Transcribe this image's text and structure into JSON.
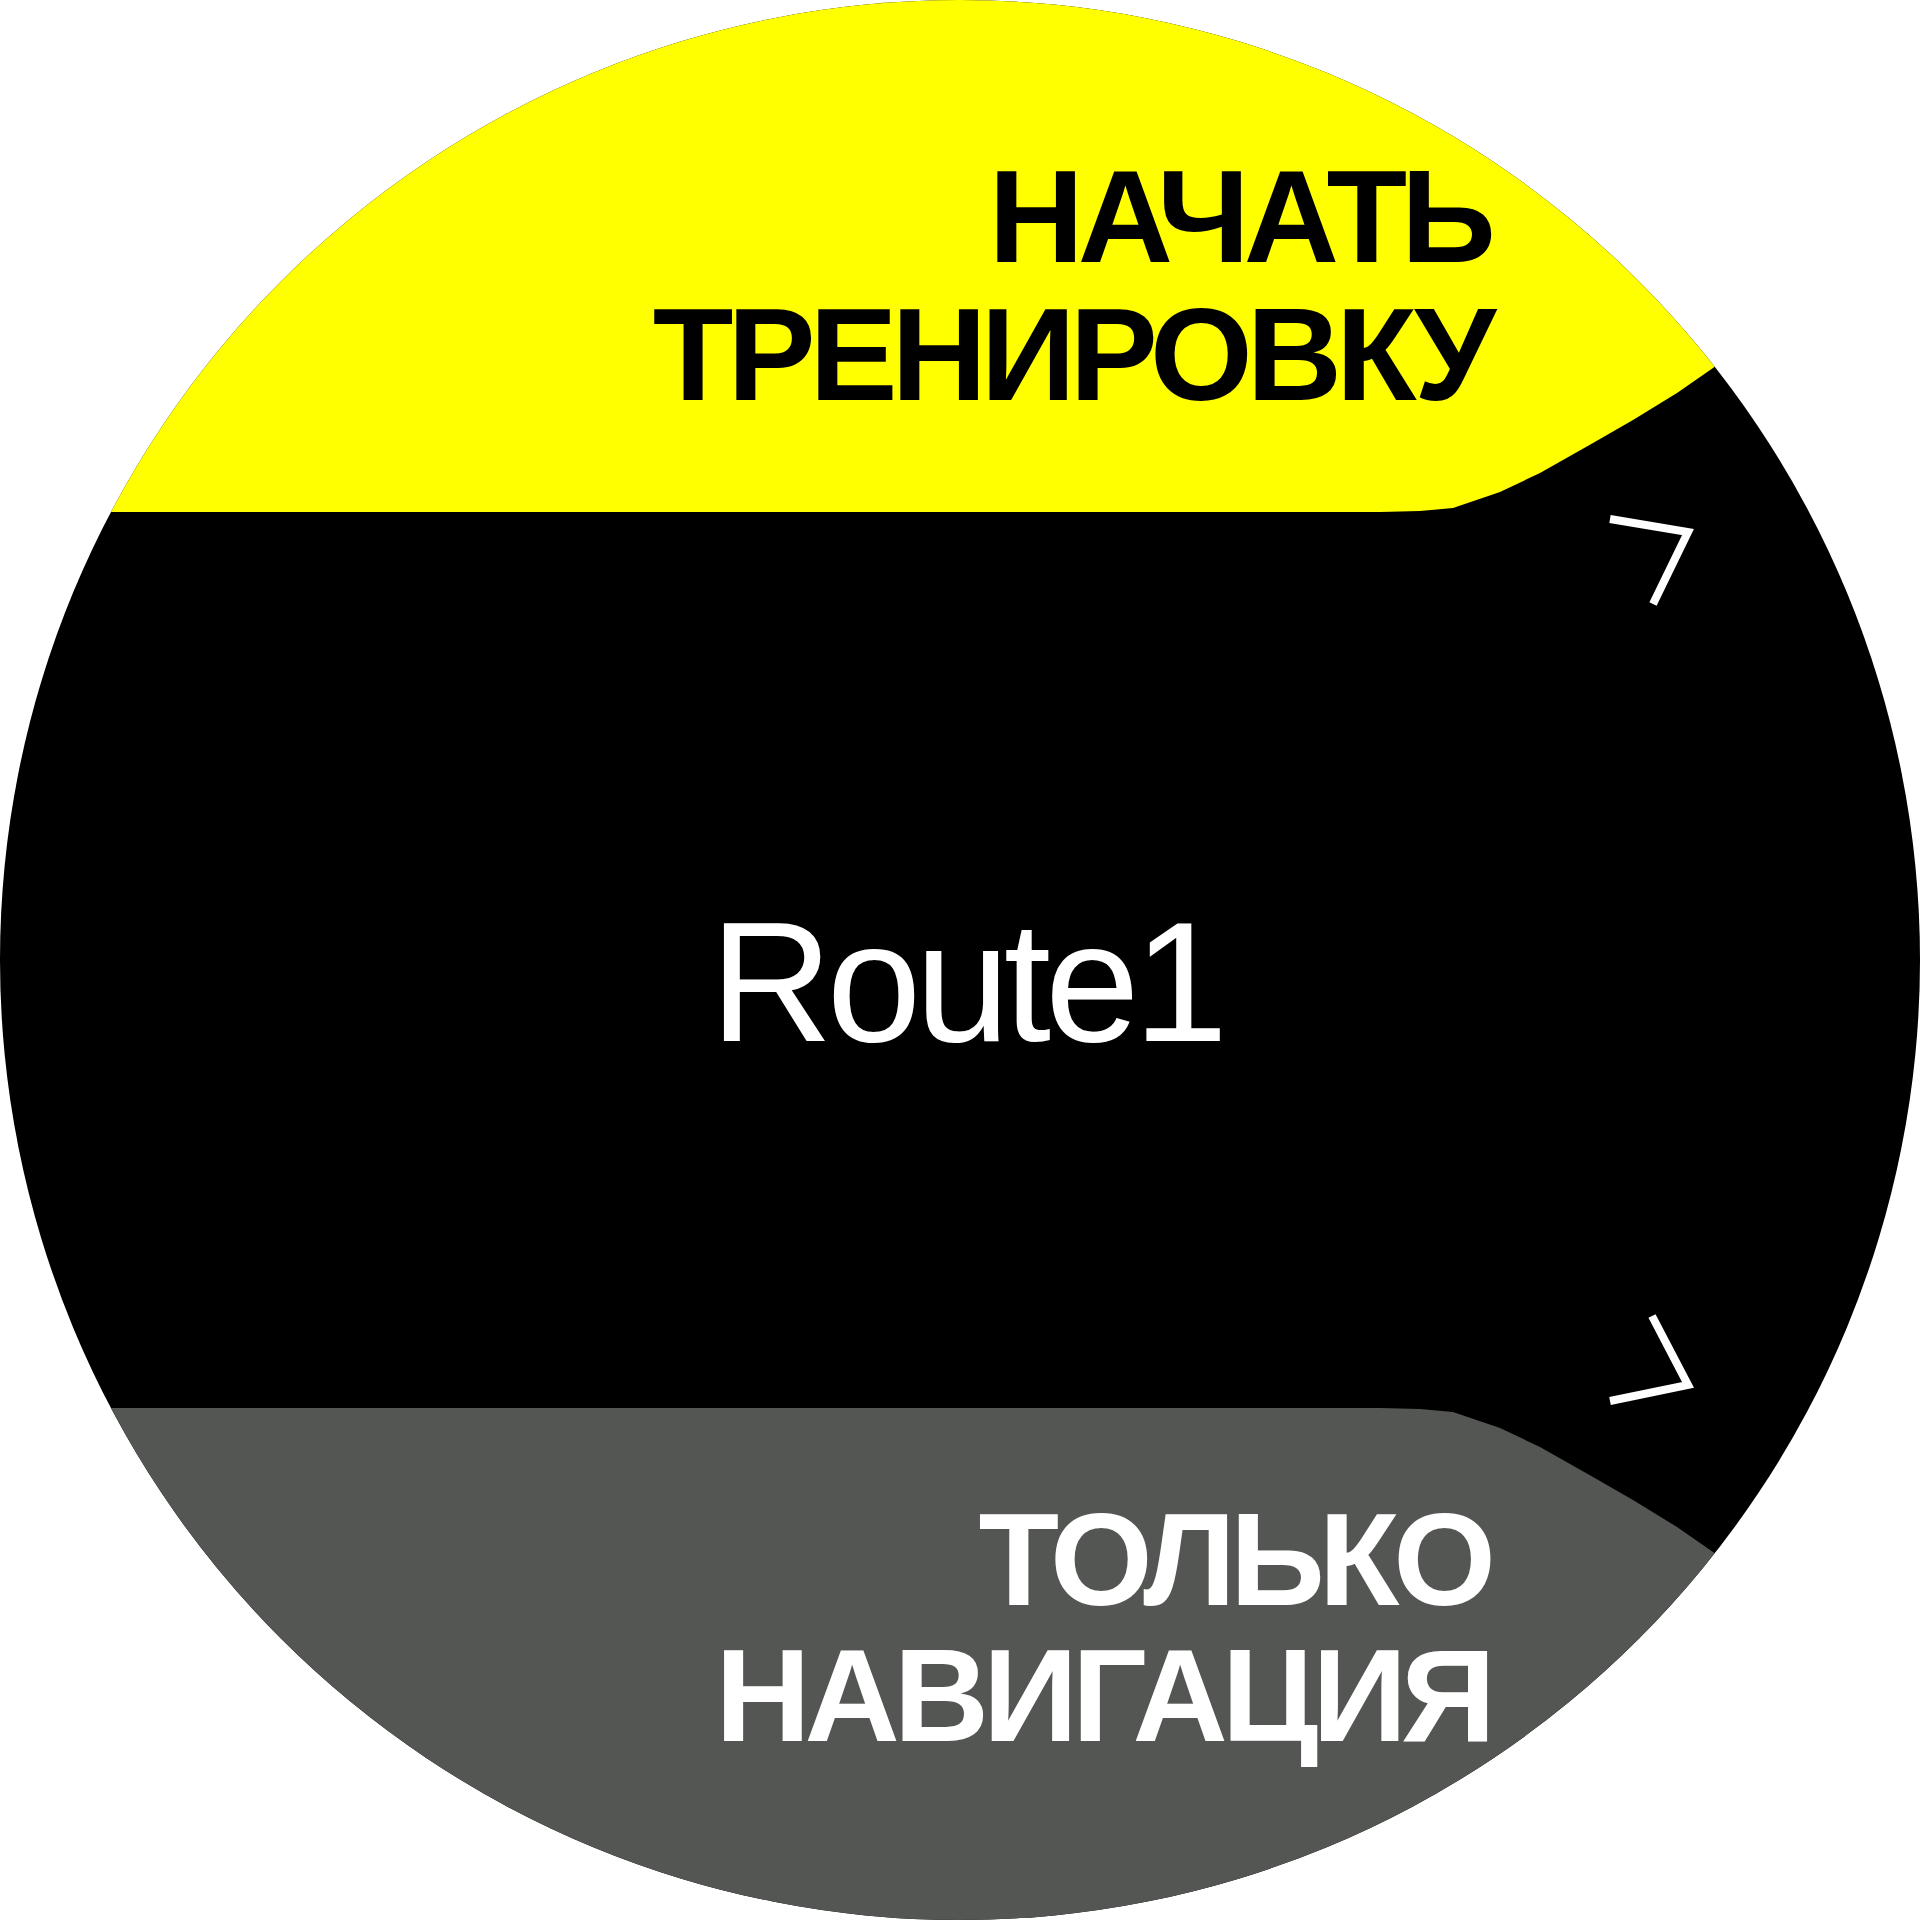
{
  "top_button": {
    "label": "НАЧАТЬ ТРЕНИРОВКУ"
  },
  "route": {
    "name": "Route1"
  },
  "bottom_button": {
    "label": "ТОЛЬКО НАВИГАЦИЯ"
  }
}
